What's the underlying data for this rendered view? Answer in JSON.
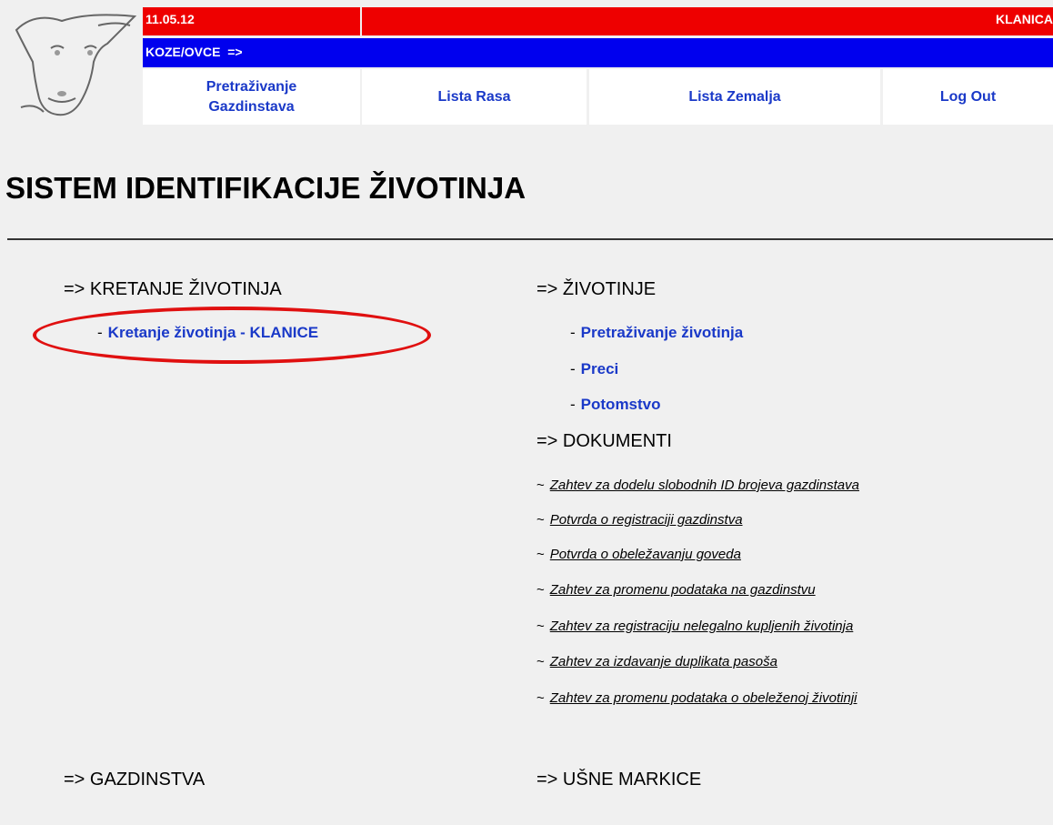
{
  "header": {
    "date": "11.05.12",
    "module": "KLANICA",
    "species": "KOZE/OVCE  =>"
  },
  "nav": [
    {
      "label": "Pretraživanje\nGazdinstava"
    },
    {
      "label": "Lista Rasa"
    },
    {
      "label": "Lista Zemalja"
    },
    {
      "label": "Log Out"
    }
  ],
  "page_title": "SISTEM IDENTIFIKACIJE ŽIVOTINJA",
  "sections": {
    "kretanje": {
      "title": "=> KRETANJE ŽIVOTINJA",
      "links": [
        "Kretanje životinja - KLANICE"
      ]
    },
    "zivotinje": {
      "title": "=> ŽIVOTINJE",
      "links": [
        "Pretraživanje životinja",
        "Preci",
        "Potomstvo"
      ]
    },
    "dokumenti": {
      "title": "=> DOKUMENTI",
      "links": [
        "Zahtev za dodelu slobodnih ID brojeva gazdinstava",
        "Potvrda o registraciji gazdinstva",
        "Potvrda o obeležavanju goveda",
        "Zahtev za promenu podataka na gazdinstvu",
        "Zahtev za registraciju nelegalno kupljenih životinja",
        "Zahtev za izdavanje duplikata pasoša",
        "Zahtev za promenu podataka o obeleženoj životinji"
      ]
    },
    "gazdinstva": {
      "title": "=> GAZDINSTVA"
    },
    "usne_markice": {
      "title": "=> UŠNE MARKICE"
    }
  },
  "symbols": {
    "dash": "-",
    "tilde": "~"
  },
  "colors": {
    "header_red": "#ee0000",
    "header_blue": "#0000ee",
    "link_blue": "#1a39c8",
    "highlight": "#e01010"
  },
  "icons": {
    "logo": "cow-head-icon"
  }
}
